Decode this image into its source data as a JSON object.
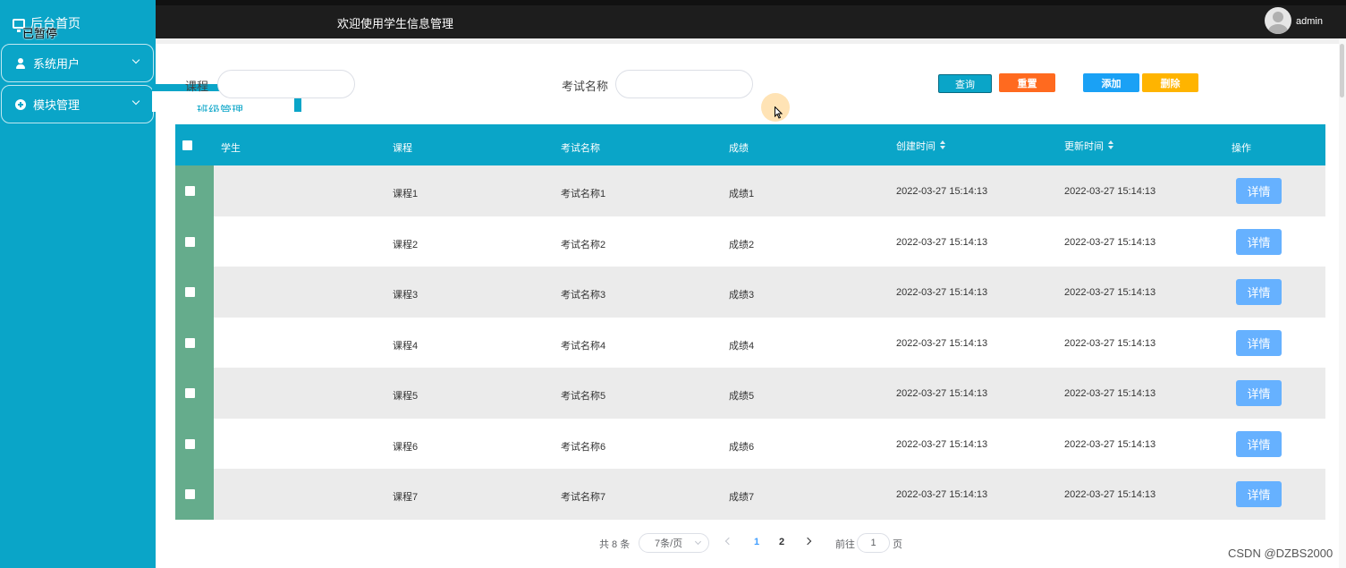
{
  "sidebar": {
    "home_label": "后台首页",
    "paused_text": "已暂停",
    "menus": [
      {
        "label": "系统用户",
        "icon": "user-icon"
      },
      {
        "label": "模块管理",
        "icon": "plus-circle-icon"
      }
    ],
    "submenu_item": "班级管理",
    "bg_color": "#0aa5c8"
  },
  "header": {
    "welcome": "欢迎使用学生信息管理",
    "username": "admin"
  },
  "search": {
    "course_label": "课程",
    "course_value": "",
    "exam_label": "考试名称",
    "exam_value": "",
    "buttons": {
      "query": "查询",
      "reset": "重置",
      "add": "添加",
      "delete": "删除"
    }
  },
  "table": {
    "headers": {
      "student": "学生",
      "course": "课程",
      "exam": "考试名称",
      "score": "成绩",
      "created": "创建时间",
      "updated": "更新时间",
      "action": "操作"
    },
    "rows": [
      {
        "student": "",
        "course": "课程1",
        "exam": "考试名称1",
        "score": "成绩1",
        "created": "2022-03-27 15:14:13",
        "updated": "2022-03-27 15:14:13",
        "action": "详情"
      },
      {
        "student": "",
        "course": "课程2",
        "exam": "考试名称2",
        "score": "成绩2",
        "created": "2022-03-27 15:14:13",
        "updated": "2022-03-27 15:14:13",
        "action": "详情"
      },
      {
        "student": "",
        "course": "课程3",
        "exam": "考试名称3",
        "score": "成绩3",
        "created": "2022-03-27 15:14:13",
        "updated": "2022-03-27 15:14:13",
        "action": "详情"
      },
      {
        "student": "",
        "course": "课程4",
        "exam": "考试名称4",
        "score": "成绩4",
        "created": "2022-03-27 15:14:13",
        "updated": "2022-03-27 15:14:13",
        "action": "详情"
      },
      {
        "student": "",
        "course": "课程5",
        "exam": "考试名称5",
        "score": "成绩5",
        "created": "2022-03-27 15:14:13",
        "updated": "2022-03-27 15:14:13",
        "action": "详情"
      },
      {
        "student": "",
        "course": "课程6",
        "exam": "考试名称6",
        "score": "成绩6",
        "created": "2022-03-27 15:14:13",
        "updated": "2022-03-27 15:14:13",
        "action": "详情"
      },
      {
        "student": "",
        "course": "课程7",
        "exam": "考试名称7",
        "score": "成绩7",
        "created": "2022-03-27 15:14:13",
        "updated": "2022-03-27 15:14:13",
        "action": "详情"
      }
    ]
  },
  "pagination": {
    "total": "共 8 条",
    "page_size": "7条/页",
    "pages": [
      "1",
      "2"
    ],
    "current_page": "1",
    "goto_label": "前往",
    "goto_value": "1",
    "page_suffix": "页"
  },
  "watermark": "CSDN @DZBS2000"
}
